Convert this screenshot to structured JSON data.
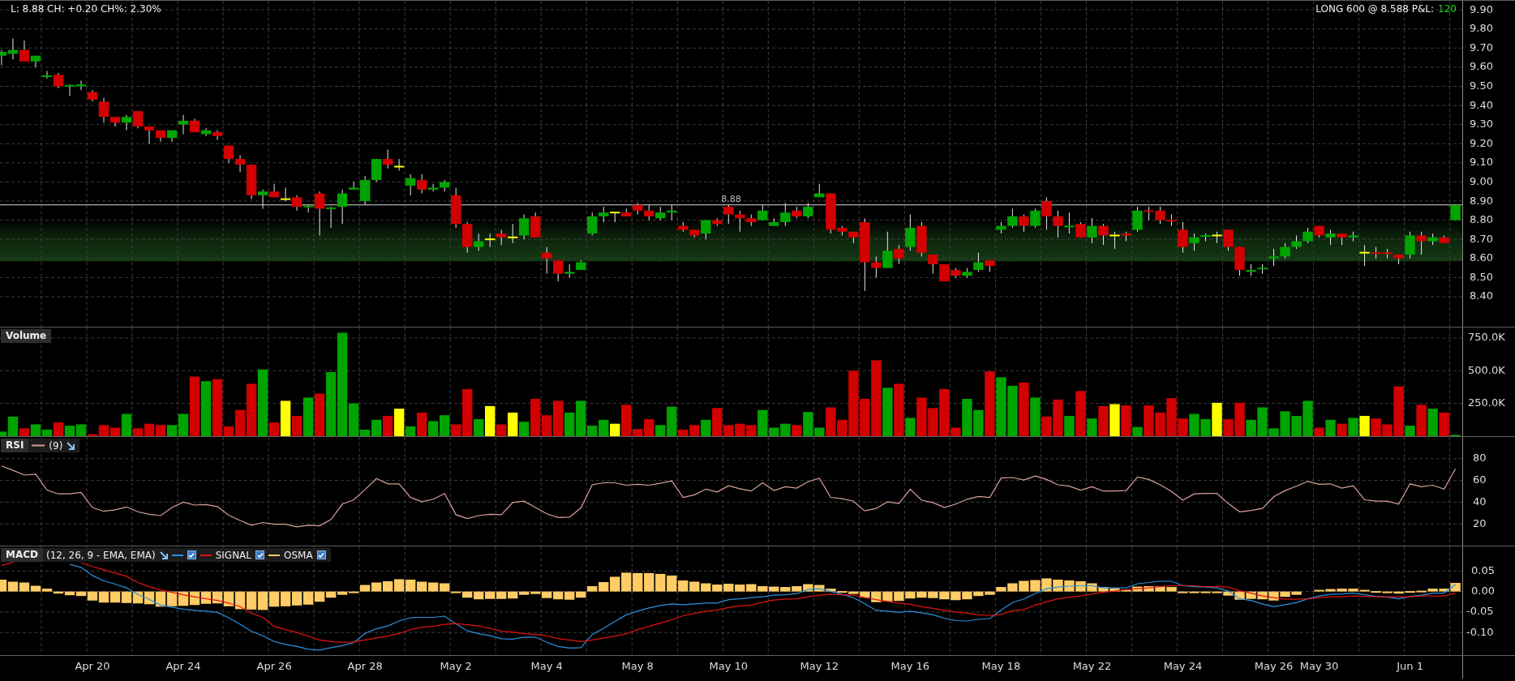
{
  "quote_summary": "L: 8.88 CH: +0.20 CH%: 2.30%",
  "position": {
    "summary": "LONG 600 @ 8.588 P&L:",
    "pnl": "120"
  },
  "price_panel": {
    "chart_data": {
      "type": "candlestick",
      "grid": true,
      "ylim": [
        8.243,
        9.947
      ],
      "yticks": [
        {
          "value": 9.9,
          "label": "9.90"
        },
        {
          "value": 9.8,
          "label": "9.80"
        },
        {
          "value": 9.7,
          "label": "9.70"
        },
        {
          "value": 9.6,
          "label": "9.60"
        },
        {
          "value": 9.5,
          "label": "9.50"
        },
        {
          "value": 9.4,
          "label": "9.40"
        },
        {
          "value": 9.3,
          "label": "9.30"
        },
        {
          "value": 9.2,
          "label": "9.20"
        },
        {
          "value": 9.1,
          "label": "9.10"
        },
        {
          "value": 9.0,
          "label": "9.00"
        },
        {
          "value": 8.9,
          "label": "8.90"
        },
        {
          "value": 8.8,
          "label": "8.80"
        },
        {
          "value": 8.7,
          "label": "8.70"
        },
        {
          "value": 8.6,
          "label": "8.60"
        },
        {
          "value": 8.5,
          "label": "8.50"
        },
        {
          "value": 8.4,
          "label": "8.40"
        }
      ],
      "bands": [
        {
          "axis": "y",
          "from": 8.585,
          "to": 8.805
        }
      ],
      "ref_lines": [
        {
          "axis": "y",
          "value": 8.88,
          "label": "8.88"
        }
      ],
      "ohlc": [
        [
          9.66,
          9.69,
          9.61,
          9.68
        ],
        [
          9.67,
          9.75,
          9.64,
          9.69
        ],
        [
          9.69,
          9.74,
          9.63,
          9.63
        ],
        [
          9.63,
          9.66,
          9.6,
          9.66
        ],
        [
          9.55,
          9.58,
          9.54,
          9.555
        ],
        [
          9.56,
          9.57,
          9.49,
          9.5
        ],
        [
          9.5,
          9.51,
          9.45,
          9.505
        ],
        [
          9.5,
          9.53,
          9.48,
          9.51
        ],
        [
          9.47,
          9.48,
          9.42,
          9.43
        ],
        [
          9.42,
          9.44,
          9.31,
          9.34
        ],
        [
          9.34,
          9.34,
          9.29,
          9.31
        ],
        [
          9.31,
          9.35,
          9.27,
          9.34
        ],
        [
          9.37,
          9.37,
          9.28,
          9.29
        ],
        [
          9.29,
          9.29,
          9.2,
          9.27
        ],
        [
          9.27,
          9.27,
          9.21,
          9.23
        ],
        [
          9.23,
          9.27,
          9.21,
          9.27
        ],
        [
          9.3,
          9.35,
          9.25,
          9.32
        ],
        [
          9.32,
          9.33,
          9.26,
          9.26
        ],
        [
          9.25,
          9.28,
          9.24,
          9.27
        ],
        [
          9.26,
          9.27,
          9.22,
          9.24
        ],
        [
          9.19,
          9.19,
          9.1,
          9.12
        ],
        [
          9.12,
          9.14,
          9.05,
          9.09
        ],
        [
          9.09,
          9.09,
          8.91,
          8.93
        ],
        [
          8.93,
          8.96,
          8.86,
          8.95
        ],
        [
          8.95,
          8.99,
          8.92,
          8.92
        ],
        [
          8.91,
          8.97,
          8.9,
          8.91
        ],
        [
          8.92,
          8.93,
          8.85,
          8.87
        ],
        [
          8.87,
          8.88,
          8.84,
          8.875
        ],
        [
          8.94,
          8.95,
          8.72,
          8.86
        ],
        [
          8.86,
          8.87,
          8.76,
          8.865
        ],
        [
          8.87,
          8.96,
          8.78,
          8.94
        ],
        [
          8.96,
          9.0,
          8.96,
          8.97
        ],
        [
          8.9,
          9.03,
          8.88,
          9.01
        ],
        [
          9.01,
          9.12,
          9.0,
          9.12
        ],
        [
          9.12,
          9.17,
          9.07,
          9.09
        ],
        [
          9.08,
          9.12,
          9.06,
          9.08
        ],
        [
          8.98,
          9.04,
          8.93,
          9.02
        ],
        [
          9.01,
          9.04,
          8.94,
          8.96
        ],
        [
          8.96,
          8.99,
          8.95,
          8.97
        ],
        [
          8.97,
          9.01,
          8.95,
          9.0
        ],
        [
          8.93,
          8.97,
          8.76,
          8.78
        ],
        [
          8.78,
          8.79,
          8.63,
          8.66
        ],
        [
          8.66,
          8.73,
          8.64,
          8.69
        ],
        [
          8.7,
          8.73,
          8.66,
          8.7
        ],
        [
          8.73,
          8.75,
          8.67,
          8.71
        ],
        [
          8.71,
          8.78,
          8.68,
          8.71
        ],
        [
          8.72,
          8.83,
          8.7,
          8.81
        ],
        [
          8.82,
          8.84,
          8.71,
          8.71
        ],
        [
          8.63,
          8.66,
          8.52,
          8.6
        ],
        [
          8.59,
          8.59,
          8.48,
          8.52
        ],
        [
          8.52,
          8.57,
          8.5,
          8.53
        ],
        [
          8.54,
          8.59,
          8.54,
          8.58
        ],
        [
          8.73,
          8.84,
          8.72,
          8.82
        ],
        [
          8.82,
          8.87,
          8.79,
          8.84
        ],
        [
          8.84,
          8.84,
          8.79,
          8.84
        ],
        [
          8.84,
          8.86,
          8.82,
          8.82
        ],
        [
          8.88,
          8.89,
          8.83,
          8.85
        ],
        [
          8.85,
          8.88,
          8.8,
          8.82
        ],
        [
          8.81,
          8.87,
          8.8,
          8.84
        ],
        [
          8.84,
          8.88,
          8.8,
          8.85
        ],
        [
          8.77,
          8.79,
          8.74,
          8.75
        ],
        [
          8.75,
          8.75,
          8.71,
          8.72
        ],
        [
          8.73,
          8.8,
          8.7,
          8.8
        ],
        [
          8.8,
          8.81,
          8.77,
          8.78
        ],
        [
          8.87,
          8.88,
          8.78,
          8.83
        ],
        [
          8.83,
          8.85,
          8.74,
          8.81
        ],
        [
          8.81,
          8.83,
          8.77,
          8.79
        ],
        [
          8.8,
          8.88,
          8.8,
          8.85
        ],
        [
          8.77,
          8.81,
          8.77,
          8.79
        ],
        [
          8.79,
          8.89,
          8.77,
          8.84
        ],
        [
          8.85,
          8.87,
          8.81,
          8.82
        ],
        [
          8.82,
          8.89,
          8.81,
          8.87
        ],
        [
          8.92,
          8.99,
          8.92,
          8.94
        ],
        [
          8.94,
          8.94,
          8.73,
          8.75
        ],
        [
          8.76,
          8.77,
          8.72,
          8.74
        ],
        [
          8.74,
          8.74,
          8.68,
          8.71
        ],
        [
          8.79,
          8.81,
          8.43,
          8.58
        ],
        [
          8.58,
          8.61,
          8.5,
          8.55
        ],
        [
          8.55,
          8.74,
          8.55,
          8.64
        ],
        [
          8.65,
          8.67,
          8.57,
          8.6
        ],
        [
          8.66,
          8.83,
          8.64,
          8.76
        ],
        [
          8.77,
          8.79,
          8.61,
          8.63
        ],
        [
          8.62,
          8.62,
          8.52,
          8.57
        ],
        [
          8.57,
          8.57,
          8.48,
          8.48
        ],
        [
          8.54,
          8.55,
          8.5,
          8.51
        ],
        [
          8.51,
          8.55,
          8.5,
          8.53
        ],
        [
          8.54,
          8.63,
          8.53,
          8.58
        ],
        [
          8.59,
          8.59,
          8.53,
          8.56
        ],
        [
          8.75,
          8.79,
          8.73,
          8.77
        ],
        [
          8.77,
          8.86,
          8.76,
          8.82
        ],
        [
          8.82,
          8.83,
          8.74,
          8.77
        ],
        [
          8.77,
          8.86,
          8.76,
          8.85
        ],
        [
          8.9,
          8.92,
          8.75,
          8.82
        ],
        [
          8.82,
          8.85,
          8.71,
          8.77
        ],
        [
          8.765,
          8.84,
          8.73,
          8.77
        ],
        [
          8.78,
          8.79,
          8.71,
          8.71
        ],
        [
          8.71,
          8.81,
          8.68,
          8.77
        ],
        [
          8.77,
          8.78,
          8.67,
          8.72
        ],
        [
          8.72,
          8.74,
          8.65,
          8.72
        ],
        [
          8.73,
          8.74,
          8.69,
          8.72
        ],
        [
          8.75,
          8.87,
          8.74,
          8.85
        ],
        [
          8.85,
          8.87,
          8.8,
          8.845
        ],
        [
          8.85,
          8.87,
          8.78,
          8.8
        ],
        [
          8.8,
          8.83,
          8.77,
          8.795
        ],
        [
          8.75,
          8.79,
          8.63,
          8.66
        ],
        [
          8.68,
          8.73,
          8.64,
          8.71
        ],
        [
          8.715,
          8.73,
          8.69,
          8.72
        ],
        [
          8.72,
          8.74,
          8.68,
          8.72
        ],
        [
          8.75,
          8.75,
          8.64,
          8.66
        ],
        [
          8.66,
          8.66,
          8.51,
          8.54
        ],
        [
          8.53,
          8.57,
          8.51,
          8.54
        ],
        [
          8.545,
          8.57,
          8.52,
          8.55
        ],
        [
          8.6,
          8.65,
          8.56,
          8.61
        ],
        [
          8.61,
          8.68,
          8.6,
          8.66
        ],
        [
          8.66,
          8.72,
          8.65,
          8.69
        ],
        [
          8.69,
          8.76,
          8.68,
          8.74
        ],
        [
          8.77,
          8.77,
          8.71,
          8.72
        ],
        [
          8.71,
          8.75,
          8.67,
          8.73
        ],
        [
          8.73,
          8.73,
          8.67,
          8.71
        ],
        [
          8.71,
          8.74,
          8.69,
          8.72
        ],
        [
          8.63,
          8.67,
          8.56,
          8.63
        ],
        [
          8.63,
          8.66,
          8.6,
          8.625
        ],
        [
          8.63,
          8.65,
          8.6,
          8.625
        ],
        [
          8.62,
          8.62,
          8.57,
          8.6
        ],
        [
          8.62,
          8.74,
          8.6,
          8.72
        ],
        [
          8.72,
          8.74,
          8.62,
          8.69
        ],
        [
          8.69,
          8.73,
          8.67,
          8.71
        ],
        [
          8.71,
          8.72,
          8.68,
          8.68
        ],
        [
          8.8,
          8.88,
          8.8,
          8.88
        ]
      ]
    }
  },
  "volume_panel": {
    "chart_data": {
      "type": "bar",
      "grid": true,
      "ylim": [
        0,
        830
      ],
      "yticks": [
        {
          "value": 750,
          "label": "750.0K"
        },
        {
          "value": 500,
          "label": "500.0K"
        },
        {
          "value": 250,
          "label": "250.0K"
        }
      ],
      "series": [
        {
          "name": "Volume",
          "values": [
            35,
            150,
            60,
            90,
            50,
            105,
            80,
            90,
            15,
            85,
            65,
            170,
            60,
            95,
            85,
            85,
            170,
            455,
            420,
            435,
            75,
            200,
            400,
            510,
            105,
            270,
            155,
            295,
            325,
            490,
            790,
            250,
            50,
            125,
            155,
            210,
            75,
            180,
            115,
            160,
            90,
            360,
            130,
            230,
            90,
            180,
            110,
            285,
            160,
            270,
            180,
            270,
            80,
            125,
            95,
            240,
            55,
            130,
            85,
            225,
            50,
            85,
            125,
            215,
            85,
            95,
            85,
            200,
            65,
            95,
            85,
            185,
            65,
            220,
            125,
            500,
            285,
            580,
            370,
            400,
            140,
            295,
            215,
            360,
            65,
            285,
            200,
            495,
            450,
            385,
            410,
            295,
            150,
            280,
            155,
            345,
            135,
            230,
            245,
            235,
            70,
            235,
            180,
            290,
            135,
            170,
            130,
            255,
            130,
            255,
            125,
            220,
            60,
            190,
            155,
            270,
            65,
            125,
            95,
            140,
            155,
            135,
            90,
            380,
            80,
            240,
            210,
            180,
            10
          ]
        }
      ]
    }
  },
  "rsi_panel": {
    "legend": "(9)",
    "chart_data": {
      "type": "line",
      "grid": true,
      "ylim": [
        0,
        100
      ],
      "yticks": [
        {
          "value": 80,
          "label": "80"
        },
        {
          "value": 60,
          "label": "60"
        },
        {
          "value": 40,
          "label": "40"
        },
        {
          "value": 20,
          "label": "20"
        }
      ],
      "series": [
        {
          "name": "RSI",
          "color": "#d9a19a",
          "values": [
            73.3,
            69.3,
            64.9,
            65.8,
            51.1,
            47.6,
            47.6,
            48.9,
            35.1,
            31.6,
            32.9,
            35.6,
            31.1,
            28.9,
            27.6,
            35.1,
            40,
            37.3,
            37.8,
            36,
            28,
            23.1,
            18.7,
            21.3,
            19.6,
            19.6,
            17.3,
            18.7,
            18.2,
            24,
            38.2,
            42.2,
            51.6,
            61.8,
            56.9,
            56.9,
            44.4,
            40.4,
            42.7,
            48,
            28.4,
            24.9,
            27.6,
            28.9,
            28.4,
            39.6,
            40.9,
            35.1,
            29.3,
            25.8,
            26.2,
            34.7,
            56,
            57.8,
            57.8,
            55.6,
            56.4,
            55.6,
            57.3,
            59.6,
            44.4,
            46.7,
            52,
            49.3,
            55.1,
            52.4,
            50.2,
            57.8,
            50.7,
            54.2,
            52.9,
            58.7,
            62,
            44.4,
            43.1,
            40.9,
            32,
            34.2,
            40.4,
            38.7,
            52,
            41.8,
            39.6,
            35.1,
            38.2,
            42.7,
            45.3,
            44.4,
            62.2,
            62.7,
            60.4,
            64,
            60.9,
            56,
            54.7,
            51.1,
            54.2,
            50.2,
            50.2,
            50.7,
            63.1,
            60.9,
            56,
            49.8,
            41.8,
            47.6,
            48,
            48,
            38.7,
            31.1,
            32.4,
            34.2,
            44.9,
            50.7,
            54.7,
            59.1,
            56.4,
            56.9,
            52.9,
            55.1,
            42.2,
            40.9,
            40.9,
            38.2,
            56.9,
            54.2,
            55.6,
            52,
            70.7
          ]
        }
      ]
    }
  },
  "macd_panel": {
    "title": "MACD",
    "params": "(12, 26, 9 - EMA, EMA)",
    "checkboxes": [
      {
        "checked": true
      },
      {
        "checked": true
      },
      {
        "checked": true
      }
    ],
    "chart_data": {
      "type": "line",
      "grid": true,
      "legend": "upper left",
      "ylim": [
        -0.155,
        0.11
      ],
      "categories": [
        null,
        null,
        null,
        null,
        null,
        null,
        null,
        null,
        "Apr 20",
        null,
        null,
        null,
        null,
        null,
        null,
        null,
        "Apr 24",
        null,
        null,
        null,
        null,
        null,
        null,
        null,
        "Apr 26",
        null,
        null,
        null,
        null,
        null,
        null,
        null,
        "Apr 28",
        null,
        null,
        null,
        null,
        null,
        null,
        null,
        "May 2",
        null,
        null,
        null,
        null,
        null,
        null,
        null,
        "May 4",
        null,
        null,
        null,
        null,
        null,
        null,
        null,
        "May 8",
        null,
        null,
        null,
        null,
        null,
        null,
        null,
        "May 10",
        null,
        null,
        null,
        null,
        null,
        null,
        null,
        "May 12",
        null,
        null,
        null,
        null,
        null,
        null,
        null,
        "May 16",
        null,
        null,
        null,
        null,
        null,
        null,
        null,
        "May 18",
        null,
        null,
        null,
        null,
        null,
        null,
        null,
        "May 22",
        null,
        null,
        null,
        null,
        null,
        null,
        null,
        "May 24",
        null,
        null,
        null,
        null,
        null,
        null,
        null,
        "May 26",
        null,
        null,
        null,
        "May 30",
        null,
        null,
        null,
        null,
        null,
        null,
        null,
        "Jun 1",
        null,
        null,
        null,
        null
      ],
      "yticks": [
        {
          "value": 0.05,
          "label": "0.05"
        },
        {
          "value": 0,
          "label": "0.00"
        },
        {
          "value": -0.05,
          "label": "-0.05"
        },
        {
          "value": -0.1,
          "label": "-0.10"
        }
      ],
      "series": [
        {
          "type": "line",
          "color": "#2b90e0",
          "values": [
            null,
            null,
            null,
            null,
            null,
            null,
            0.066,
            0.059,
            0.039,
            0.026,
            0.018,
            0.009,
            -0.007,
            -0.019,
            -0.033,
            -0.038,
            -0.043,
            -0.046,
            -0.048,
            -0.051,
            -0.064,
            -0.08,
            -0.097,
            -0.108,
            -0.122,
            -0.129,
            -0.134,
            -0.141,
            -0.143,
            -0.137,
            -0.132,
            -0.125,
            -0.102,
            -0.091,
            -0.084,
            -0.072,
            -0.064,
            -0.063,
            -0.063,
            -0.06,
            -0.079,
            -0.096,
            -0.103,
            -0.108,
            -0.115,
            -0.116,
            -0.111,
            -0.111,
            -0.124,
            -0.134,
            -0.138,
            -0.137,
            -0.105,
            -0.09,
            -0.073,
            -0.057,
            -0.048,
            -0.04,
            -0.034,
            -0.03,
            -0.032,
            -0.03,
            -0.028,
            -0.028,
            -0.02,
            -0.018,
            -0.015,
            -0.013,
            -0.009,
            -0.008,
            -0.005,
            0.005,
            0.007,
            0.0,
            -0.007,
            -0.015,
            -0.03,
            -0.046,
            -0.048,
            -0.051,
            -0.048,
            -0.052,
            -0.057,
            -0.065,
            -0.071,
            -0.072,
            -0.068,
            -0.066,
            -0.045,
            -0.027,
            -0.018,
            -0.005,
            0.007,
            0.011,
            0.013,
            0.014,
            0.014,
            0.009,
            0.009,
            0.009,
            0.019,
            0.022,
            0.025,
            0.025,
            0.014,
            0.012,
            0.011,
            0.009,
            0.001,
            -0.018,
            -0.022,
            -0.03,
            -0.037,
            -0.032,
            -0.027,
            -0.018,
            -0.011,
            -0.007,
            -0.006,
            -0.004,
            -0.008,
            -0.012,
            -0.014,
            -0.018,
            -0.012,
            -0.009,
            -0.004,
            -0.004,
            0.017
          ]
        },
        {
          "name": "SIGNAL",
          "type": "line",
          "color": "#e01414",
          "values": [
            0.064,
            0.071,
            null,
            null,
            null,
            null,
            null,
            0.07,
            0.061,
            0.053,
            0.045,
            0.037,
            0.022,
            0.012,
            0.004,
            -0.002,
            -0.008,
            -0.013,
            -0.018,
            -0.022,
            -0.028,
            -0.037,
            -0.053,
            -0.063,
            -0.085,
            -0.093,
            -0.1,
            -0.109,
            -0.118,
            -0.122,
            -0.124,
            -0.123,
            -0.118,
            -0.113,
            -0.109,
            -0.102,
            -0.093,
            -0.087,
            -0.085,
            -0.08,
            -0.078,
            -0.081,
            -0.084,
            -0.09,
            -0.097,
            -0.099,
            -0.103,
            -0.105,
            -0.108,
            -0.115,
            -0.118,
            -0.122,
            -0.118,
            -0.113,
            -0.109,
            -0.103,
            -0.093,
            -0.085,
            -0.077,
            -0.069,
            -0.059,
            -0.054,
            -0.048,
            -0.045,
            -0.039,
            -0.035,
            -0.033,
            -0.026,
            -0.021,
            -0.019,
            -0.018,
            -0.013,
            -0.009,
            -0.007,
            -0.008,
            -0.009,
            -0.015,
            -0.02,
            -0.024,
            -0.028,
            -0.031,
            -0.037,
            -0.041,
            -0.046,
            -0.05,
            -0.053,
            -0.057,
            -0.058,
            -0.056,
            -0.047,
            -0.044,
            -0.033,
            -0.025,
            -0.018,
            -0.014,
            -0.011,
            -0.006,
            -0.002,
            0.001,
            0.005,
            0.007,
            0.009,
            0.012,
            0.014,
            0.015,
            0.014,
            0.012,
            0.012,
            0.011,
            0.002,
            -0.004,
            -0.011,
            -0.015,
            -0.019,
            -0.019,
            -0.018,
            -0.015,
            -0.013,
            -0.013,
            -0.011,
            -0.012,
            -0.013,
            -0.013,
            -0.013,
            -0.013,
            -0.011,
            -0.011,
            -0.011,
            -0.004
          ]
        },
        {
          "name": "OSMA",
          "type": "bar",
          "color": "#ffcc66",
          "values": [
            0.029,
            0.024,
            0.022,
            0.014,
            0.007,
            -0.005,
            -0.009,
            -0.011,
            -0.022,
            -0.027,
            -0.027,
            -0.028,
            -0.029,
            -0.031,
            -0.037,
            -0.036,
            -0.035,
            -0.033,
            -0.03,
            -0.029,
            -0.036,
            -0.043,
            -0.044,
            -0.045,
            -0.037,
            -0.036,
            -0.034,
            -0.032,
            -0.025,
            -0.015,
            -0.008,
            -0.002,
            0.016,
            0.022,
            0.025,
            0.03,
            0.029,
            0.024,
            0.022,
            0.02,
            -0.001,
            -0.015,
            -0.019,
            -0.018,
            -0.018,
            -0.017,
            -0.008,
            -0.006,
            -0.016,
            -0.019,
            -0.02,
            -0.015,
            0.013,
            0.023,
            0.036,
            0.046,
            0.045,
            0.045,
            0.043,
            0.039,
            0.027,
            0.024,
            0.02,
            0.017,
            0.019,
            0.017,
            0.018,
            0.013,
            0.012,
            0.011,
            0.013,
            0.018,
            0.016,
            0.007,
            0.001,
            -0.006,
            -0.015,
            -0.026,
            -0.024,
            -0.023,
            -0.017,
            -0.015,
            -0.016,
            -0.019,
            -0.021,
            -0.019,
            -0.011,
            -0.008,
            0.011,
            0.02,
            0.026,
            0.028,
            0.032,
            0.029,
            0.027,
            0.025,
            0.02,
            0.011,
            0.008,
            0.004,
            0.012,
            0.013,
            0.013,
            0.011,
            -0.001,
            -0.002,
            -0.001,
            -0.003,
            -0.01,
            -0.02,
            -0.018,
            -0.019,
            -0.022,
            -0.013,
            -0.008,
            0.0,
            0.004,
            0.006,
            0.007,
            0.007,
            0.004,
            0.001,
            -0.001,
            -0.005,
            0.001,
            0.002,
            0.007,
            0.007,
            0.021
          ]
        }
      ]
    }
  }
}
